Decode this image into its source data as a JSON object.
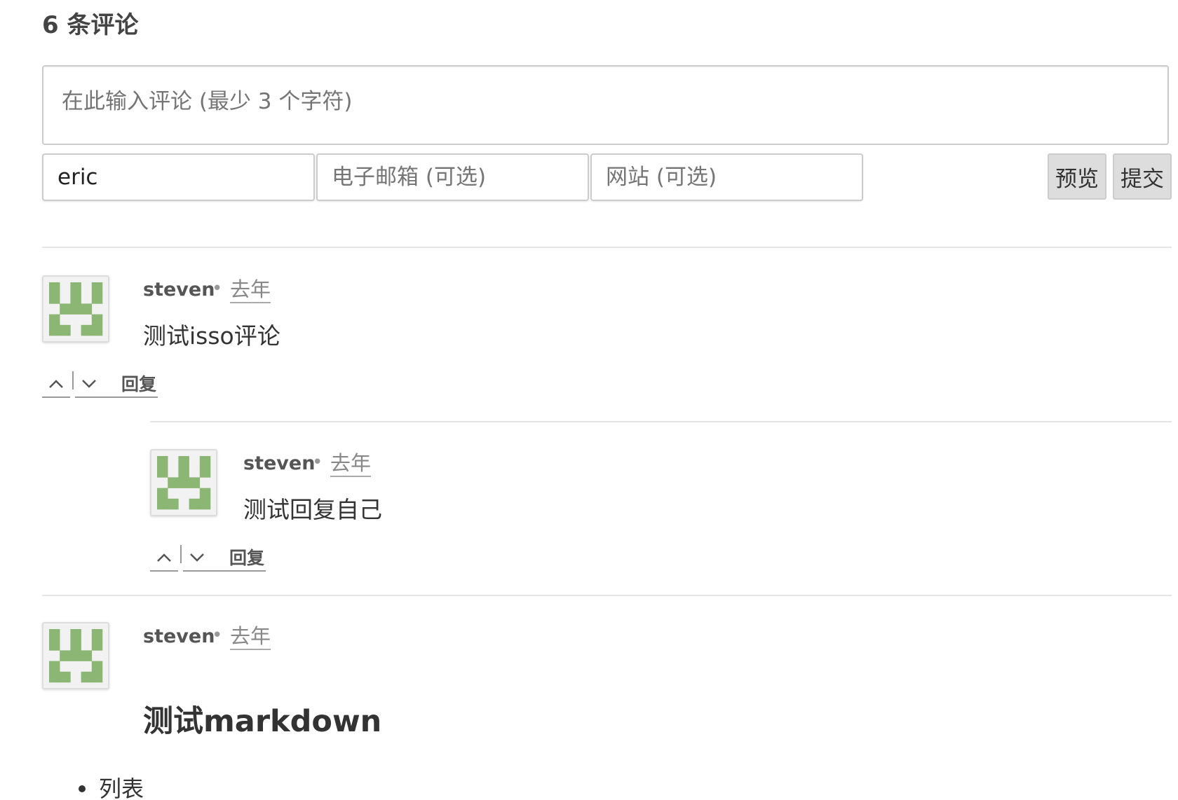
{
  "comments_section": {
    "count_title": "6 条评论"
  },
  "postbox": {
    "textarea_placeholder": "在此输入评论 (最少 3 个字符)",
    "author_value": "eric",
    "email_placeholder": "电子邮箱 (可选)",
    "website_placeholder": "网站 (可选)",
    "preview_label": "预览",
    "submit_label": "提交"
  },
  "comments": [
    {
      "author": "steven",
      "separator": "•",
      "time": "去年",
      "text": "测试isso评论",
      "reply_label": "回复"
    },
    {
      "author": "steven",
      "separator": "•",
      "time": "去年",
      "text": "测试回复自己",
      "reply_label": "回复"
    },
    {
      "author": "steven",
      "separator": "•",
      "time": "去年",
      "heading": "测试markdown",
      "list_items": [
        "列表"
      ]
    }
  ],
  "icons": {
    "upvote": "chevron-up-icon",
    "downvote": "chevron-down-icon",
    "avatar": "identicon"
  },
  "colors": {
    "identicon": "#8bb673",
    "avatar_bg": "#f2f2f2",
    "button_bg": "#dddddd",
    "separator": "#e5e5e5"
  }
}
